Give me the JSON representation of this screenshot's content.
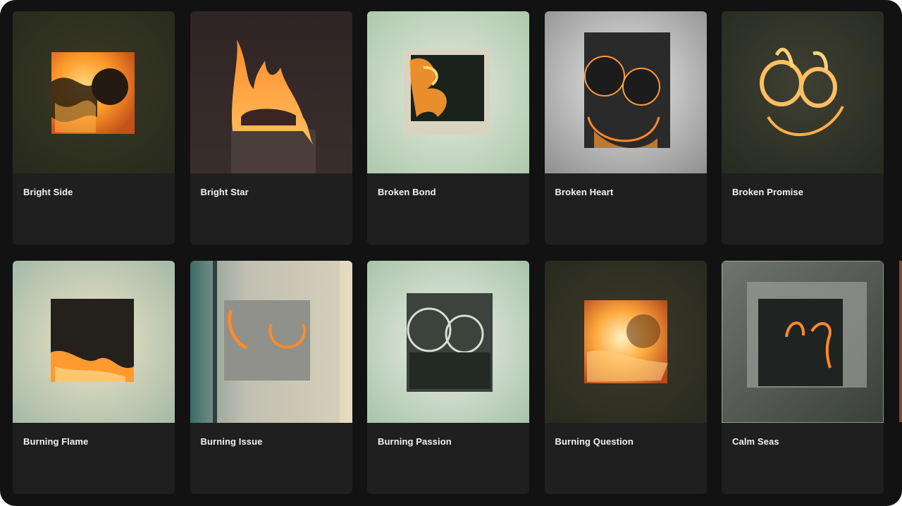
{
  "gallery": {
    "items": [
      {
        "title": "Bright Side"
      },
      {
        "title": "Bright Star"
      },
      {
        "title": "Broken Bond"
      },
      {
        "title": "Broken Heart"
      },
      {
        "title": "Broken Promise"
      },
      {
        "title": "Burning Flame"
      },
      {
        "title": "Burning Issue"
      },
      {
        "title": "Burning Passion"
      },
      {
        "title": "Burning Question"
      },
      {
        "title": "Calm Seas"
      }
    ]
  },
  "colors": {
    "page_background": "#121212",
    "card_background": "#1f1f1f",
    "title_text": "#f2f2f2",
    "flame_orange": "#ff9a2a"
  }
}
